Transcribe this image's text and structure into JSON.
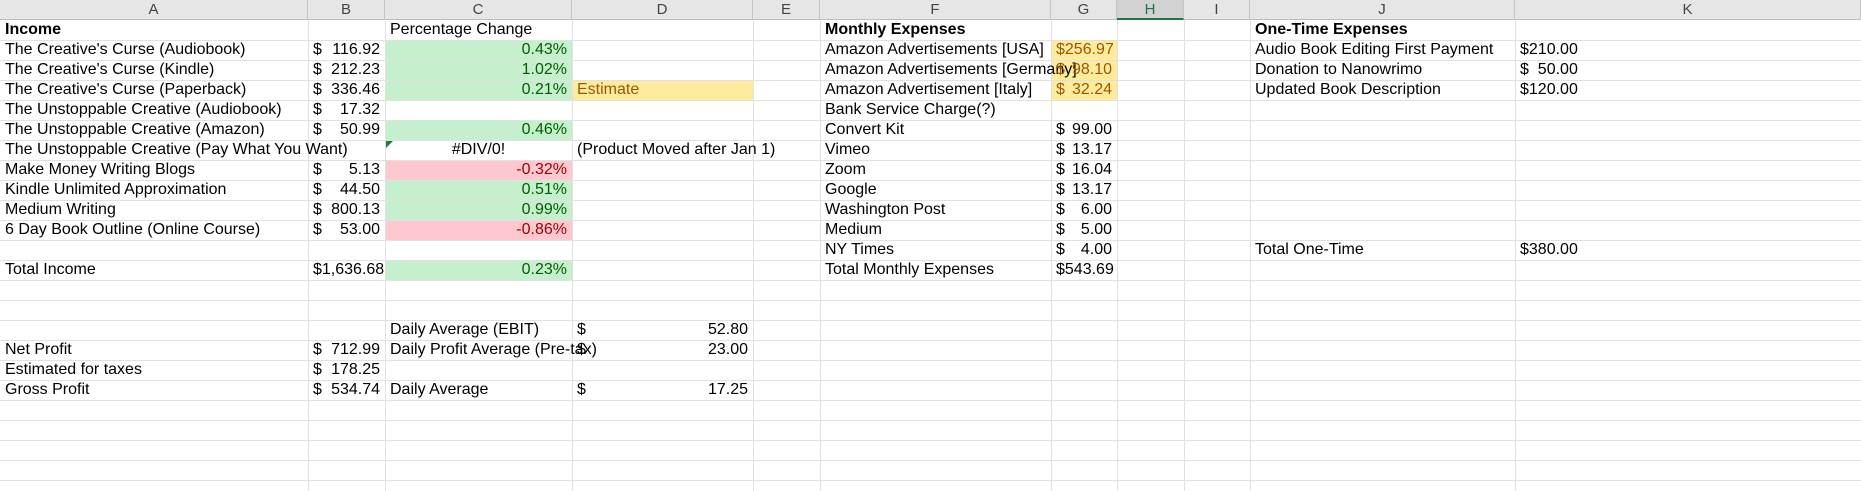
{
  "column_headers": [
    "A",
    "B",
    "C",
    "D",
    "E",
    "F",
    "G",
    "H",
    "I",
    "J",
    "K"
  ],
  "selected_column": "H",
  "colors": {
    "green_fill": "#c6efce",
    "red_fill": "#ffc7ce",
    "yellow_fill": "#ffeb9c",
    "header_bg": "#e6e6e6",
    "gridline": "#e1e1e1"
  },
  "income": {
    "header": "Income",
    "pct_header": "Percentage Change",
    "rows": [
      {
        "label": "The Creative's Curse (Audiobook)",
        "cur": "$",
        "amount": "116.92",
        "pct": "0.43%"
      },
      {
        "label": "The Creative's Curse (Kindle)",
        "cur": "$",
        "amount": "212.23",
        "pct": "1.02%"
      },
      {
        "label": "The Creative's Curse (Paperback)",
        "cur": "$",
        "amount": "336.46",
        "pct": "0.21%",
        "note": "Estimate"
      },
      {
        "label": "The Unstoppable Creative (Audiobook)",
        "cur": "$",
        "amount": "17.32",
        "pct": ""
      },
      {
        "label": "The Unstoppable Creative (Amazon)",
        "cur": "$",
        "amount": "50.99",
        "pct": "0.46%"
      },
      {
        "label": "The Unstoppable Creative (Pay What You Want)",
        "cur": "",
        "amount": "",
        "pct": "#DIV/0!",
        "note": "(Product Moved after Jan 1)"
      },
      {
        "label": "Make Money Writing Blogs",
        "cur": "$",
        "amount": "5.13",
        "pct": "-0.32%"
      },
      {
        "label": "Kindle Unlimited Approximation",
        "cur": "$",
        "amount": "44.50",
        "pct": "0.51%"
      },
      {
        "label": "Medium Writing",
        "cur": "$",
        "amount": "800.13",
        "pct": "0.99%"
      },
      {
        "label": "6 Day Book Outline (Online Course)",
        "cur": "$",
        "amount": "53.00",
        "pct": "-0.86%"
      }
    ],
    "total_label": "Total Income",
    "total_amount": "$1,636.68",
    "total_pct": "0.23%"
  },
  "summary": {
    "daily_ebit_label": "Daily Average (EBIT)",
    "daily_ebit_cur": "$",
    "daily_ebit_value": "52.80",
    "net_profit_label": "Net Profit",
    "net_profit_cur": "$",
    "net_profit_value": "712.99",
    "daily_profit_label": "Daily Profit Average (Pre-tax)",
    "daily_profit_cur": "$",
    "daily_profit_value": "23.00",
    "taxes_label": "Estimated for taxes",
    "taxes_cur": "$",
    "taxes_value": "178.25",
    "gross_profit_label": "Gross Profit",
    "gross_profit_cur": "$",
    "gross_profit_value": "534.74",
    "daily_avg_label": "Daily Average",
    "daily_avg_cur": "$",
    "daily_avg_value": "17.25"
  },
  "monthly": {
    "header": "Monthly Expenses",
    "rows": [
      {
        "label": "Amazon Advertisements [USA]",
        "cur": "$",
        "amount": "256.97"
      },
      {
        "label": "Amazon Advertisements [Germany]",
        "cur": "$",
        "amount": "98.10"
      },
      {
        "label": "Amazon Advertisement [Italy]",
        "cur": "$",
        "amount": "32.24"
      },
      {
        "label": "Bank Service Charge(?)",
        "cur": "",
        "amount": ""
      },
      {
        "label": "Convert Kit",
        "cur": "$",
        "amount": "99.00"
      },
      {
        "label": "Vimeo",
        "cur": "$",
        "amount": "13.17"
      },
      {
        "label": "Zoom",
        "cur": "$",
        "amount": "16.04"
      },
      {
        "label": "Google",
        "cur": "$",
        "amount": "13.17"
      },
      {
        "label": "Washington Post",
        "cur": "$",
        "amount": "6.00"
      },
      {
        "label": "Medium",
        "cur": "$",
        "amount": "5.00"
      },
      {
        "label": "NY Times",
        "cur": "$",
        "amount": "4.00"
      }
    ],
    "total_label": "Total Monthly Expenses",
    "total_amount": "$543.69"
  },
  "onetime": {
    "header": "One-Time Expenses",
    "rows": [
      {
        "label": "Audio Book Editing First Payment",
        "cur": "$",
        "amount": "210.00"
      },
      {
        "label": "Donation to Nanowrimo",
        "cur": "$",
        "amount": "50.00"
      },
      {
        "label": "Updated Book Description",
        "cur": "$",
        "amount": "120.00"
      }
    ],
    "total_label": "Total One-Time",
    "total_amount": "$380.00"
  }
}
